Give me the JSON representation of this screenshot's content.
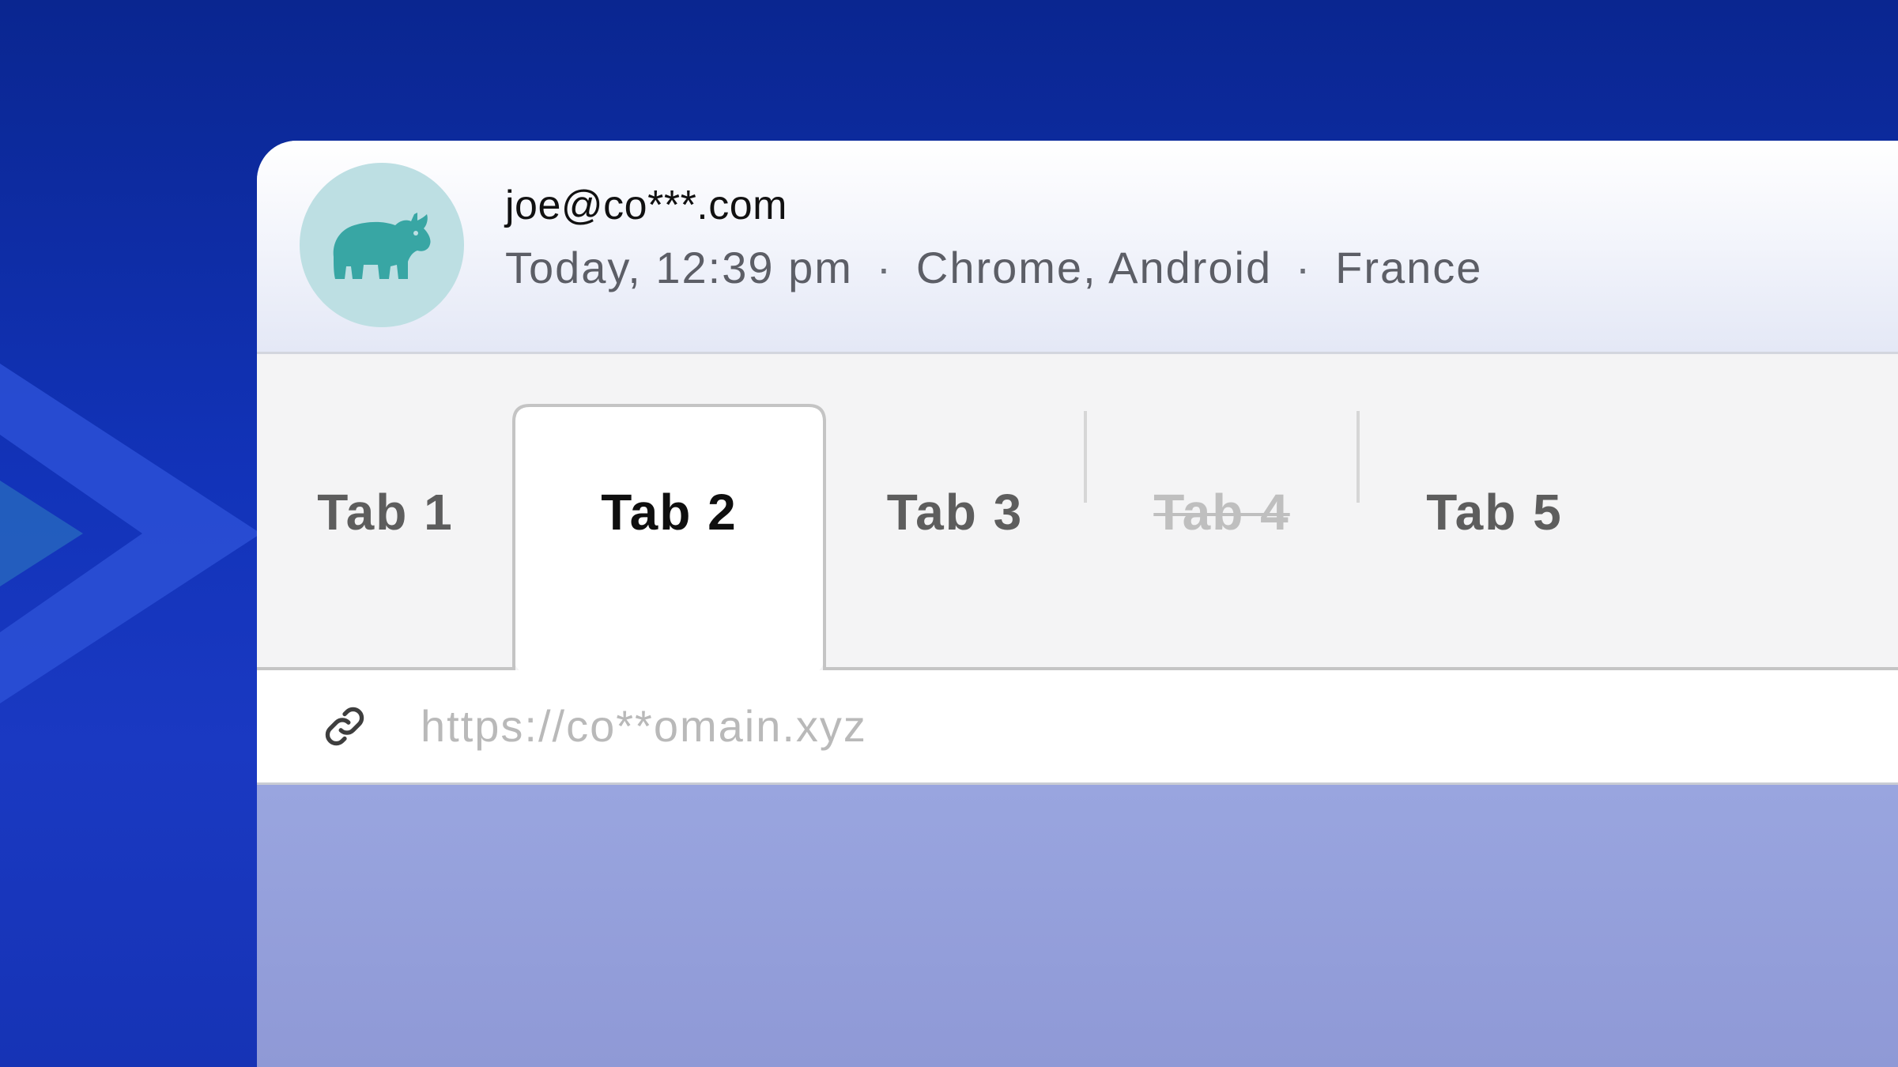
{
  "colors": {
    "background_accent": "#1233b9",
    "avatar_background": "#bddfe3",
    "avatar_icon": "#38a6a4",
    "active_tab_text": "#0f0f0f",
    "inactive_tab_text": "#5d5d5d",
    "disabled_tab_text": "#bfbfbf",
    "url_text": "#b9b9b9"
  },
  "header": {
    "avatar_icon": "rhino-icon",
    "email": "joe@co***.com",
    "time": "Today, 12:39 pm",
    "separator": "·",
    "device": "Chrome, Android",
    "country": "France"
  },
  "tabs": [
    {
      "label": "Tab 1",
      "state": "inactive"
    },
    {
      "label": "Tab 2",
      "state": "active"
    },
    {
      "label": "Tab 3",
      "state": "inactive"
    },
    {
      "label": "Tab 4",
      "state": "disabled"
    },
    {
      "label": "Tab 5",
      "state": "inactive"
    }
  ],
  "url_bar": {
    "icon": "link-icon",
    "url": "https://co**omain.xyz"
  }
}
